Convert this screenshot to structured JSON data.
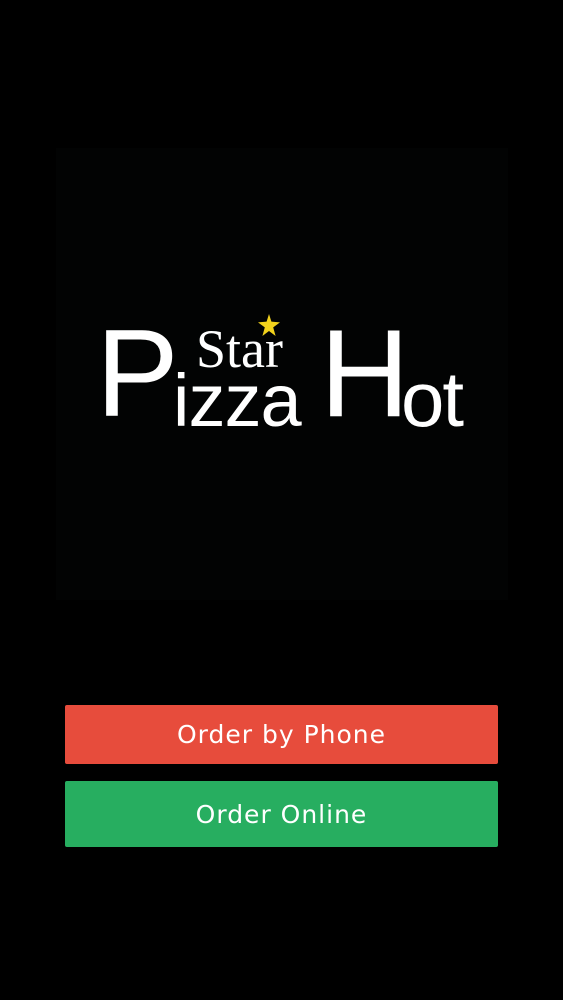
{
  "logo": {
    "letter_p": "P",
    "letters_izza": "izza",
    "letter_h": "H",
    "letters_ot": "ot",
    "star_word": "Star",
    "star_color": "#f2d21c",
    "panel_color": "#020303"
  },
  "buttons": {
    "order_by_phone": "Order by Phone",
    "order_online": "Order Online",
    "phone_color": "#e74c3c",
    "online_color": "#27ae60"
  },
  "icons": {
    "logo_star": "star-icon"
  }
}
